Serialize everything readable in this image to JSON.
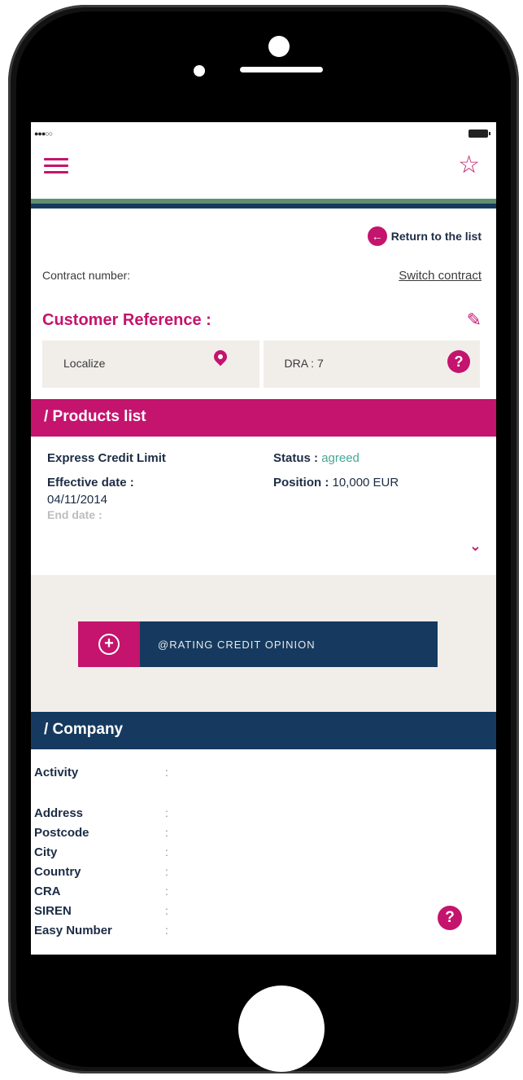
{
  "status_bar": {
    "signal": "●●●○○"
  },
  "header": {
    "menu_icon": "hamburger-icon",
    "favorite_icon": "star-icon",
    "favorite_glyph": "☆"
  },
  "nav": {
    "return_label": "Return to the list",
    "return_glyph": "←"
  },
  "contract": {
    "label": "Contract number:",
    "switch_label": "Switch contract"
  },
  "customer": {
    "reference_label": "Customer Reference :",
    "edit_glyph": "✎"
  },
  "info": {
    "localize_label": "Localize",
    "dra_label": "DRA : 7",
    "help_glyph": "?"
  },
  "products": {
    "section_title": "/ Products list",
    "name": "Express Credit Limit",
    "status_label": "Status : ",
    "status_value": "agreed",
    "effective_label": "Effective date :",
    "effective_value": "04/11/2014",
    "end_label": "End date :",
    "position_label": "Position : ",
    "position_value": "10,000 EUR",
    "expand_glyph": "⌄"
  },
  "rating": {
    "plus_glyph": "+",
    "label": "@RATING CREDIT OPINION"
  },
  "company": {
    "section_title": "/ Company",
    "colon": ":",
    "fields": [
      "Activity",
      "Address",
      "Postcode",
      "City",
      "Country",
      "CRA",
      "SIREN",
      "Easy Number"
    ],
    "help_glyph": "?"
  },
  "colors": {
    "accent": "#c4146d",
    "navy": "#163a5f",
    "green_stripe": "#5f8f6f",
    "status_green": "#45a894"
  }
}
